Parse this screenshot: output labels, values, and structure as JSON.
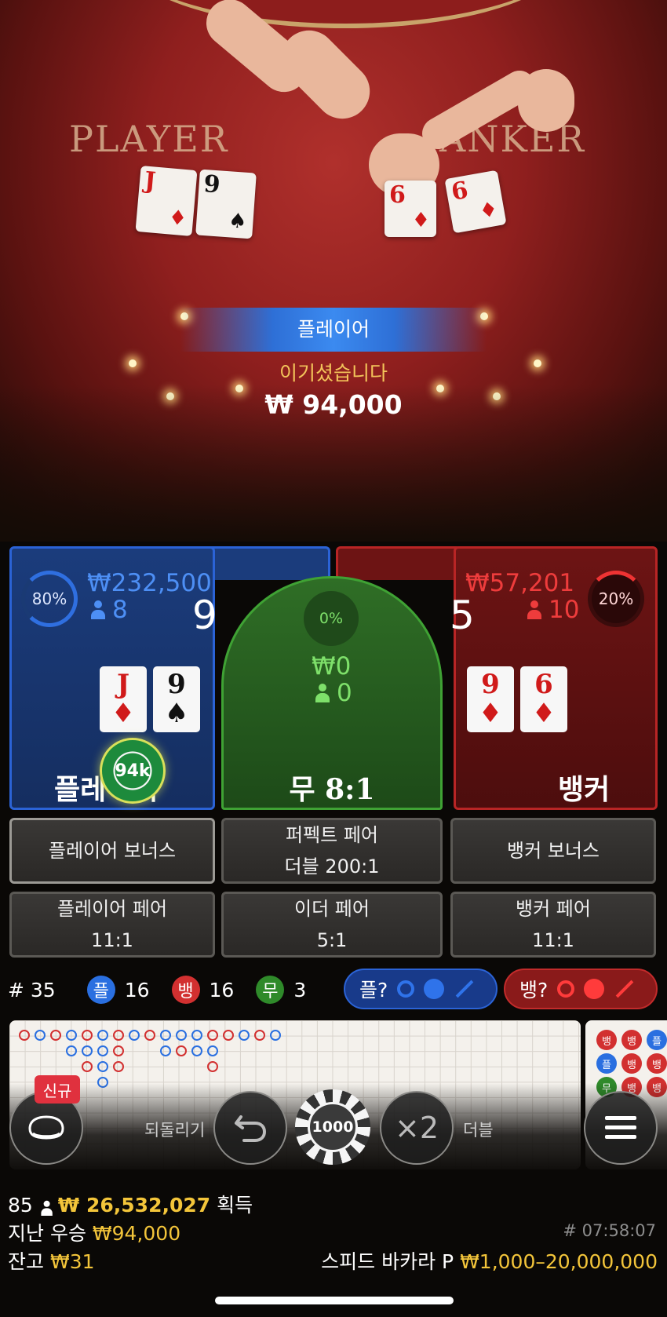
{
  "table": {
    "player_label": "PLAYER",
    "banker_label": "ANKER",
    "cards": [
      {
        "rank": "J",
        "suit": "♦",
        "color": "red"
      },
      {
        "rank": "9",
        "suit": "♠",
        "color": "black"
      },
      {
        "rank": "6",
        "suit": "♦",
        "color": "red"
      },
      {
        "rank": "6",
        "suit": "♦",
        "color": "red"
      }
    ]
  },
  "win_banner": {
    "side": "플레이어",
    "message": "이기셨습니다",
    "amount": "₩ 94,000"
  },
  "player_spot": {
    "percent": "80%",
    "amount": "₩232,500",
    "players": "8",
    "score": "9",
    "cards": [
      {
        "rank": "J",
        "suit": "♦"
      },
      {
        "rank": "9",
        "suit": "♠"
      }
    ],
    "label": "플레이어",
    "chip": "94k"
  },
  "tie_spot": {
    "percent": "0%",
    "amount": "₩0",
    "players": "0",
    "label": "무 8:1"
  },
  "banker_spot": {
    "percent": "20%",
    "amount": "₩57,201",
    "players": "10",
    "score": "5",
    "cards": [
      {
        "rank": "9",
        "suit": "♦"
      },
      {
        "rank": "6",
        "suit": "♦"
      }
    ],
    "label": "뱅커"
  },
  "side_bets": {
    "player_bonus": "플레이어 보너스",
    "perfect_pair": "퍼펙트 페어",
    "perfect_pair_odds": "더블 200:1",
    "banker_bonus": "뱅커 보너스",
    "player_pair": "플레이어 페어",
    "player_pair_odds": "11:1",
    "either_pair": "이더 페어",
    "either_pair_odds": "5:1",
    "banker_pair": "뱅커 페어",
    "banker_pair_odds": "11:1"
  },
  "stats": {
    "round": "# 35",
    "player_tag": "플",
    "player_count": "16",
    "banker_tag": "뱅",
    "banker_count": "16",
    "tie_tag": "무",
    "tie_count": "3",
    "player_predict": "플?",
    "banker_predict": "뱅?"
  },
  "roadmap": {
    "bead_labels": [
      "뱅",
      "뱅",
      "플",
      "플",
      "뱅",
      "뱅",
      "무",
      "뱅",
      "뱅"
    ]
  },
  "controls": {
    "new_badge": "신규",
    "undo_label": "되돌리기",
    "chip_value": "1000",
    "double_icon_text": "×2",
    "double_label": "더블"
  },
  "footer": {
    "players_online": "85",
    "total_won": "₩ 26,532,027",
    "won_label": "획득",
    "last_win_label": "지난 우승",
    "last_win_amount": "₩94,000",
    "game_id": "# 07:58:07",
    "balance_label": "잔고",
    "balance_amount": "₩31",
    "table_name": "스피드 바카라 P",
    "limits": "₩1,000–20,000,000"
  },
  "colors": {
    "player_blue": "#2b63d6",
    "banker_red": "#b82525",
    "tie_green": "#3fa234",
    "gold": "#f3c53a"
  }
}
